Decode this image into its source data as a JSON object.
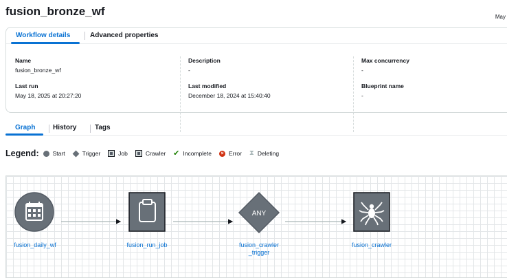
{
  "header": {
    "title": "fusion_bronze_wf",
    "date_fragment": "May"
  },
  "details": {
    "tabs": [
      {
        "label": "Workflow details",
        "active": true
      },
      {
        "label": "Advanced properties",
        "active": false
      }
    ],
    "fields": {
      "name": {
        "label": "Name",
        "value": "fusion_bronze_wf"
      },
      "description": {
        "label": "Description",
        "value": "-"
      },
      "max_concurrency": {
        "label": "Max concurrency",
        "value": "-"
      },
      "last_run": {
        "label": "Last run",
        "value": "May 18, 2025 at 20:27:20"
      },
      "last_modified": {
        "label": "Last modified",
        "value": "December 18, 2024 at 15:40:40"
      },
      "blueprint_name": {
        "label": "Blueprint name",
        "value": "-"
      }
    }
  },
  "graph_tabs": [
    {
      "label": "Graph",
      "active": true
    },
    {
      "label": "History",
      "active": false
    },
    {
      "label": "Tags",
      "active": false
    }
  ],
  "legend": {
    "title": "Legend:",
    "items": [
      {
        "label": "Start",
        "icon": "start-circle-icon"
      },
      {
        "label": "Trigger",
        "icon": "trigger-diamond-icon"
      },
      {
        "label": "Job",
        "icon": "job-square-icon"
      },
      {
        "label": "Crawler",
        "icon": "crawler-square-icon"
      },
      {
        "label": "Incomplete",
        "icon": "check-icon"
      },
      {
        "label": "Error",
        "icon": "error-icon"
      },
      {
        "label": "Deleting",
        "icon": "hourglass-icon"
      }
    ]
  },
  "graph": {
    "nodes": [
      {
        "type": "start",
        "label": "fusion_daily_wf",
        "icon": "calendar-icon"
      },
      {
        "type": "job",
        "label": "fusion_run_job",
        "icon": "clipboard-icon"
      },
      {
        "type": "trigger",
        "label": "fusion_crawler\n_trigger",
        "badge": "ANY"
      },
      {
        "type": "crawler",
        "label": "fusion_crawler",
        "icon": "spider-icon"
      }
    ],
    "colors": {
      "node_fill": "#687078",
      "node_border": "#545b64",
      "edge": "#aab7b8",
      "label": "#0972d3"
    }
  }
}
